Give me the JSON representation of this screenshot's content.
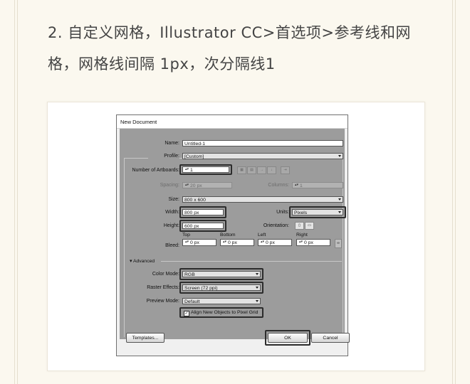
{
  "heading": "2. 自定义网格，Illustrator CC>首选项>参考线和网格，网格线间隔 1px，次分隔线1",
  "dialog": {
    "title": "New Document",
    "name_label": "Name:",
    "name_value": "Untitled-1",
    "profile_label": "Profile:",
    "profile_value": "[Custom]",
    "artboards_label": "Number of Artboards:",
    "artboards_value": "1",
    "spacing_label": "Spacing:",
    "spacing_value": "20 px",
    "columns_label": "Columns:",
    "columns_value": "1",
    "size_label": "Size:",
    "size_value": "800 x 600",
    "width_label": "Width:",
    "width_value": "800 px",
    "units_label": "Units:",
    "units_value": "Pixels",
    "height_label": "Height:",
    "height_value": "600 px",
    "orientation_label": "Orientation:",
    "bleed_label": "Bleed:",
    "bleed": [
      {
        "header": "Top",
        "value": "0 px"
      },
      {
        "header": "Bottom",
        "value": "0 px"
      },
      {
        "header": "Left",
        "value": "0 px"
      },
      {
        "header": "Right",
        "value": "0 px"
      }
    ],
    "advanced_label": "Advanced",
    "color_mode_label": "Color Mode:",
    "color_mode_value": "RGB",
    "raster_label": "Raster Effects:",
    "raster_value": "Screen (72 ppi)",
    "preview_label": "Preview Mode:",
    "preview_value": "Default",
    "pixel_grid_label": "Align New Objects to Pixel Grid",
    "pixel_grid_checked": true,
    "templates_button": "Templates...",
    "ok_button": "OK",
    "cancel_button": "Cancel"
  }
}
